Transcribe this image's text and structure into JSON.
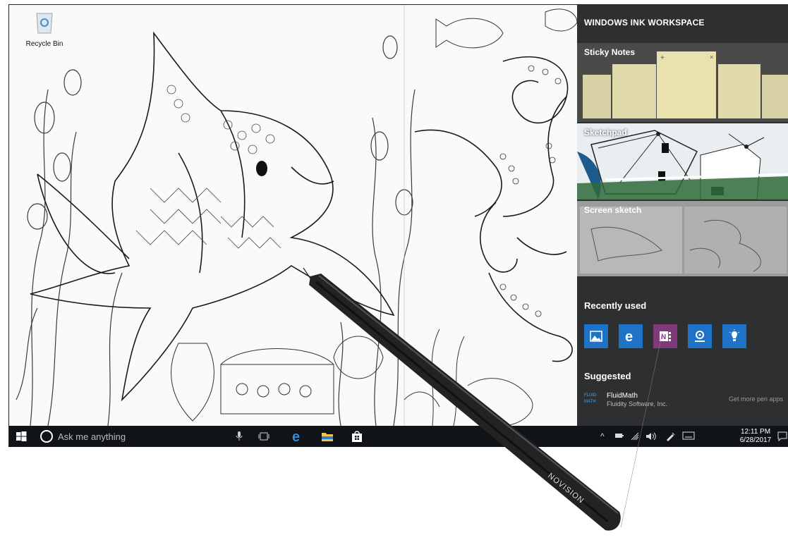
{
  "desktop": {
    "recycle_bin_label": "Recycle Bin"
  },
  "taskbar": {
    "search_placeholder": "Ask me anything",
    "apps": [
      "mic-icon",
      "task-view-icon",
      "edge-icon",
      "file-explorer-icon",
      "store-icon"
    ],
    "clock_time": "12:11 PM",
    "clock_date": "6/28/2017"
  },
  "ink_workspace": {
    "title": "WINDOWS INK WORKSPACE",
    "tiles": [
      {
        "label": "Sticky Notes"
      },
      {
        "label": "Sketchpad"
      },
      {
        "label": "Screen sketch"
      }
    ],
    "recently_used_label": "Recently used",
    "recently_used": [
      {
        "icon": "photos-icon",
        "color": "#1e73c6"
      },
      {
        "icon": "edge-icon",
        "color": "#1e73c6"
      },
      {
        "icon": "onenote-icon",
        "color": "#80397b"
      },
      {
        "icon": "maps-icon",
        "color": "#1e73c6"
      },
      {
        "icon": "tips-icon",
        "color": "#1e73c6"
      }
    ],
    "suggested_label": "Suggested",
    "suggested": {
      "logo_line1": "FLUID",
      "logo_line2": "MATH",
      "name": "FluidMath",
      "developer": "Fluidity Software, Inc.",
      "more_link": "Get more pen apps"
    }
  },
  "pen": {
    "brand": "NOVISION"
  },
  "colors": {
    "taskbar": "#101418",
    "ink_panel": "#2d2f30",
    "accent_blue": "#1e73c6",
    "onenote_purple": "#80397b"
  }
}
